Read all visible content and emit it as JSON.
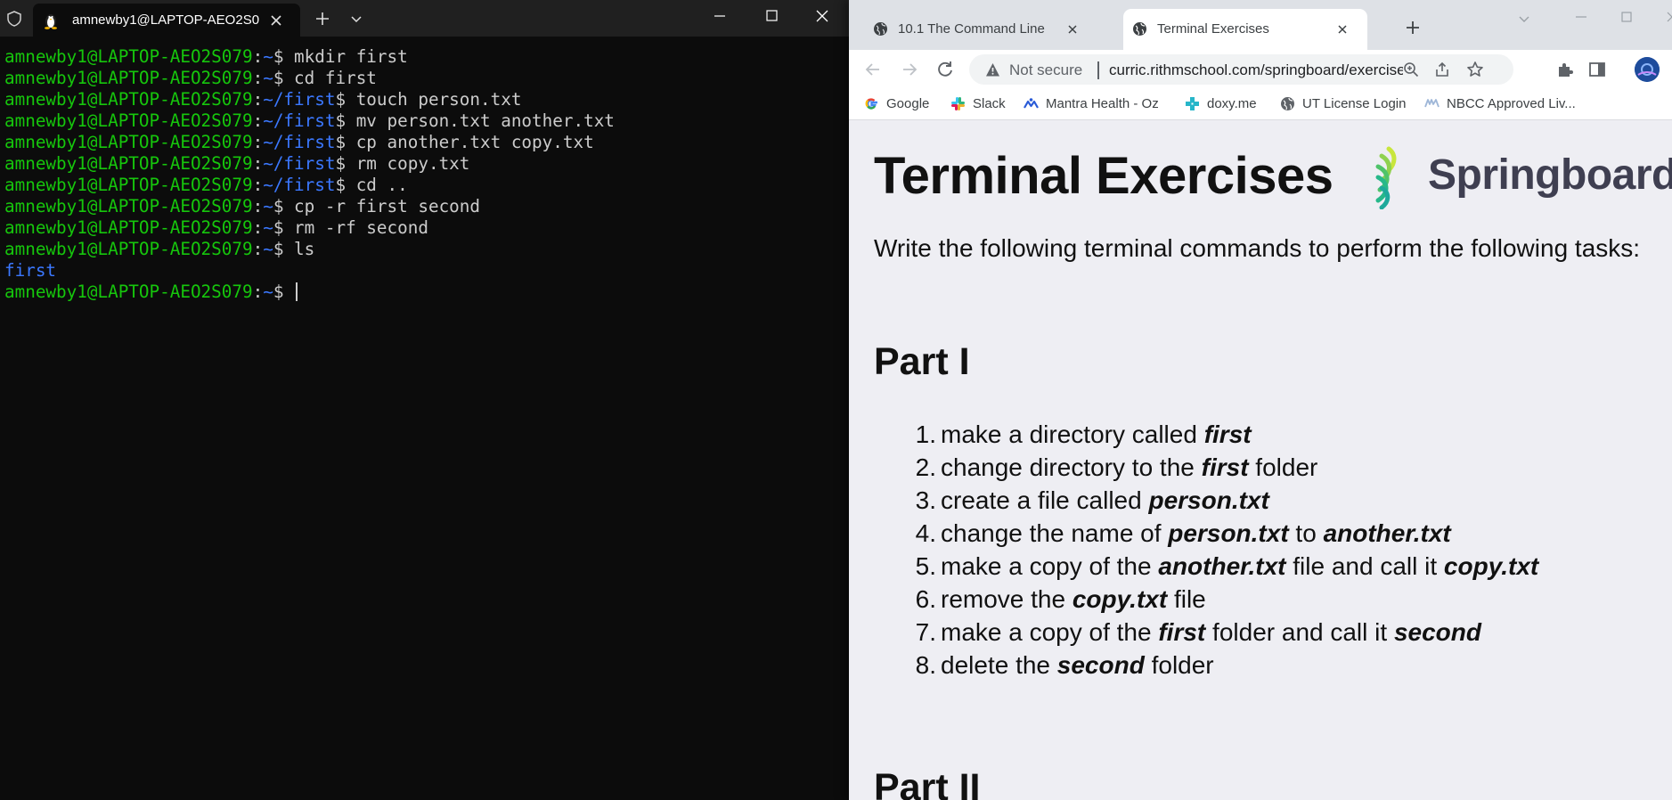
{
  "terminal": {
    "tab_title": "amnewby1@LAPTOP-AEO2S0",
    "lines": [
      {
        "user": "amnewby1@LAPTOP-AEO2S079",
        "path": "~",
        "cmd": "mkdir first"
      },
      {
        "user": "amnewby1@LAPTOP-AEO2S079",
        "path": "~",
        "cmd": "cd first"
      },
      {
        "user": "amnewby1@LAPTOP-AEO2S079",
        "path": "~/first",
        "cmd": "touch person.txt"
      },
      {
        "user": "amnewby1@LAPTOP-AEO2S079",
        "path": "~/first",
        "cmd": "mv person.txt another.txt"
      },
      {
        "user": "amnewby1@LAPTOP-AEO2S079",
        "path": "~/first",
        "cmd": "cp another.txt copy.txt"
      },
      {
        "user": "amnewby1@LAPTOP-AEO2S079",
        "path": "~/first",
        "cmd": "rm copy.txt"
      },
      {
        "user": "amnewby1@LAPTOP-AEO2S079",
        "path": "~/first",
        "cmd": "cd .."
      },
      {
        "user": "amnewby1@LAPTOP-AEO2S079",
        "path": "~",
        "cmd": "cp -r first second"
      },
      {
        "user": "amnewby1@LAPTOP-AEO2S079",
        "path": "~",
        "cmd": "rm -rf second"
      },
      {
        "user": "amnewby1@LAPTOP-AEO2S079",
        "path": "~",
        "cmd": "ls"
      }
    ],
    "output": "first",
    "prompt": {
      "user": "amnewby1@LAPTOP-AEO2S079",
      "path": "~",
      "cmd": ""
    },
    "prompt_sep": ":",
    "prompt_end": "$ ",
    "colors": {
      "user": "#16c60c",
      "path": "#3b78ff",
      "text": "#cccccc",
      "background": "#0c0c0c"
    }
  },
  "browser": {
    "tabs": [
      {
        "title": "10.1 The Command Line",
        "active": false
      },
      {
        "title": "Terminal Exercises",
        "active": true
      }
    ],
    "omnibox": {
      "security": "Not secure",
      "url": "curric.rithmschool.com/springboard/exercises/..."
    },
    "bookmarks": [
      {
        "label": "Google",
        "icon": "google-icon"
      },
      {
        "label": "Slack",
        "icon": "slack-icon"
      },
      {
        "label": "Mantra Health - Oz",
        "icon": "mantra-icon"
      },
      {
        "label": "doxy.me",
        "icon": "doxy-icon"
      },
      {
        "label": "UT License Login",
        "icon": "globe-icon"
      },
      {
        "label": "NBCC Approved Liv...",
        "icon": "nbcc-icon"
      }
    ]
  },
  "page": {
    "title": "Terminal Exercises",
    "logo_text": "Springboard",
    "intro": "Write the following terminal commands to perform the following tasks:",
    "part1": "Part I",
    "part2": "Part II",
    "tasks": [
      {
        "n": "1.",
        "parts": [
          {
            "t": "make a directory called "
          },
          {
            "t": "first",
            "em": true
          }
        ]
      },
      {
        "n": "2.",
        "parts": [
          {
            "t": "change directory to the "
          },
          {
            "t": "first",
            "em": true
          },
          {
            "t": " folder"
          }
        ]
      },
      {
        "n": "3.",
        "parts": [
          {
            "t": "create a file called "
          },
          {
            "t": "person.txt",
            "em": true
          }
        ]
      },
      {
        "n": "4.",
        "parts": [
          {
            "t": "change the name of "
          },
          {
            "t": "person.txt",
            "em": true
          },
          {
            "t": " to "
          },
          {
            "t": "another.txt",
            "em": true
          }
        ]
      },
      {
        "n": "5.",
        "parts": [
          {
            "t": "make a copy of the "
          },
          {
            "t": "another.txt",
            "em": true
          },
          {
            "t": " file and call it "
          },
          {
            "t": "copy.txt",
            "em": true
          }
        ]
      },
      {
        "n": "6.",
        "parts": [
          {
            "t": "remove the "
          },
          {
            "t": "copy.txt",
            "em": true
          },
          {
            "t": " file"
          }
        ]
      },
      {
        "n": "7.",
        "parts": [
          {
            "t": "make a copy of the "
          },
          {
            "t": "first",
            "em": true
          },
          {
            "t": " folder and call it "
          },
          {
            "t": "second",
            "em": true
          }
        ]
      },
      {
        "n": "8.",
        "parts": [
          {
            "t": "delete the "
          },
          {
            "t": "second",
            "em": true
          },
          {
            "t": " folder"
          }
        ]
      }
    ],
    "colors": {
      "background": "#eeeef3",
      "text": "#111111",
      "logo_text": "#3f3f51",
      "logo_green": "#27c48f"
    }
  }
}
